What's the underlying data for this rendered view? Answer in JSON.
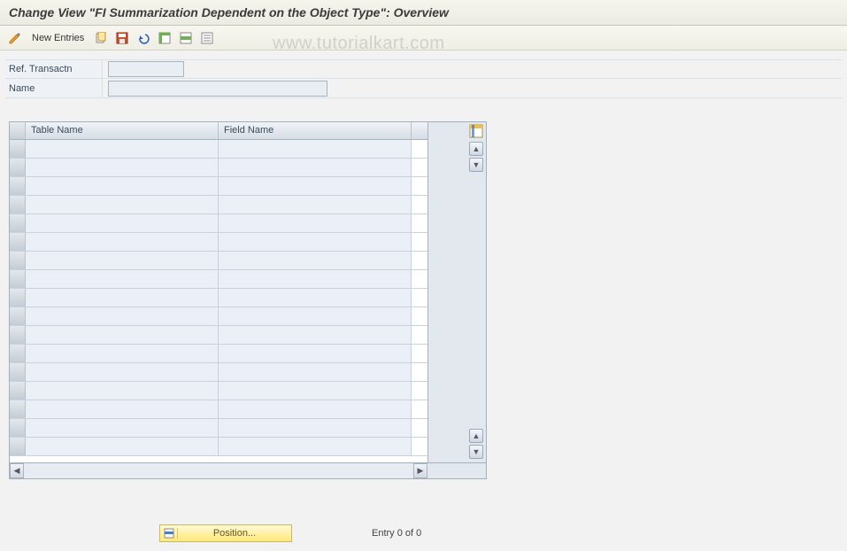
{
  "title": "Change View \"FI Summarization Dependent on the Object Type\": Overview",
  "watermark": "www.tutorialkart.com",
  "toolbar": {
    "new_entries_label": "New Entries"
  },
  "form": {
    "ref_transactn_label": "Ref. Transactn",
    "ref_transactn_value": "",
    "name_label": "Name",
    "name_value": ""
  },
  "table": {
    "columns": [
      "Table Name",
      "Field Name"
    ],
    "rows": [
      {
        "table_name": "",
        "field_name": ""
      },
      {
        "table_name": "",
        "field_name": ""
      },
      {
        "table_name": "",
        "field_name": ""
      },
      {
        "table_name": "",
        "field_name": ""
      },
      {
        "table_name": "",
        "field_name": ""
      },
      {
        "table_name": "",
        "field_name": ""
      },
      {
        "table_name": "",
        "field_name": ""
      },
      {
        "table_name": "",
        "field_name": ""
      },
      {
        "table_name": "",
        "field_name": ""
      },
      {
        "table_name": "",
        "field_name": ""
      },
      {
        "table_name": "",
        "field_name": ""
      },
      {
        "table_name": "",
        "field_name": ""
      },
      {
        "table_name": "",
        "field_name": ""
      },
      {
        "table_name": "",
        "field_name": ""
      },
      {
        "table_name": "",
        "field_name": ""
      },
      {
        "table_name": "",
        "field_name": ""
      },
      {
        "table_name": "",
        "field_name": ""
      }
    ]
  },
  "footer": {
    "position_label": "Position...",
    "entry_status": "Entry 0 of 0"
  }
}
